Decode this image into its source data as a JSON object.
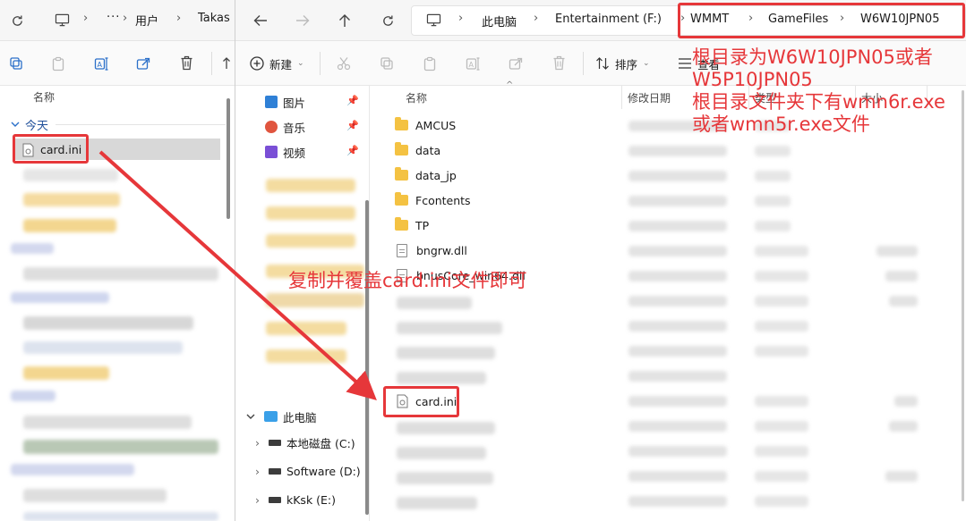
{
  "left": {
    "breadcrumb": [
      "用户",
      "Takas"
    ],
    "column_name": "名称",
    "group_today": "今天",
    "selected_file": "card.ini"
  },
  "right": {
    "breadcrumb": [
      "此电脑",
      "Entertainment (F:)",
      "WMMT",
      "GameFiles",
      "W6W10JPN05"
    ],
    "cmd": {
      "new": "新建",
      "sort": "排序",
      "view": "查看"
    },
    "nav": {
      "quick": [
        {
          "label": "图片",
          "icon": "pictures-icon",
          "color": "#2f80d6"
        },
        {
          "label": "音乐",
          "icon": "music-icon",
          "color": "#e0553f"
        },
        {
          "label": "视频",
          "icon": "video-icon",
          "color": "#7a4fd6"
        }
      ],
      "this_pc": "此电脑",
      "drives": [
        "本地磁盘 (C:)",
        "Software (D:)",
        "kKsk (E:)"
      ]
    },
    "columns": {
      "name": "名称",
      "date": "修改日期",
      "type": "类型",
      "size": "大小"
    },
    "files": [
      {
        "name": "AMCUS",
        "kind": "folder"
      },
      {
        "name": "data",
        "kind": "folder"
      },
      {
        "name": "data_jp",
        "kind": "folder"
      },
      {
        "name": "Fcontents",
        "kind": "folder"
      },
      {
        "name": "TP",
        "kind": "folder"
      },
      {
        "name": "bngrw.dll",
        "kind": "file"
      },
      {
        "name": "bnusCore_win64.dll",
        "kind": "file"
      }
    ],
    "pasted_file": "card.ini"
  },
  "annotations": {
    "root_note": [
      "根目录为W6W10JPN05或者",
      "W5P10JPN05",
      "根目录文件夹下有wmn6r.exe",
      "或者wmn5r.exe文件"
    ],
    "copy_note": "复制并覆盖card.ini文件即可"
  },
  "colors": {
    "annotation_red": "#e6373a",
    "folder_yellow": "#f4c242"
  }
}
